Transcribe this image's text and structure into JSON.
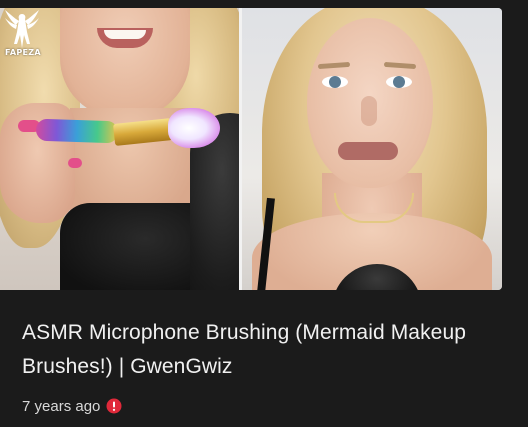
{
  "watermark": {
    "label": "FAPEZA",
    "icon": "winged-figure-icon"
  },
  "video": {
    "title": "ASMR Microphone Brushing (Mermaid Makeup Brushes!) | GwenGwiz",
    "age": "7 years ago",
    "status_icon": "alert-icon",
    "status_color": "#e0293a"
  },
  "colors": {
    "background": "#1b1b1b",
    "title_text": "#f1f1f1",
    "meta_text": "#d8d8d8"
  }
}
